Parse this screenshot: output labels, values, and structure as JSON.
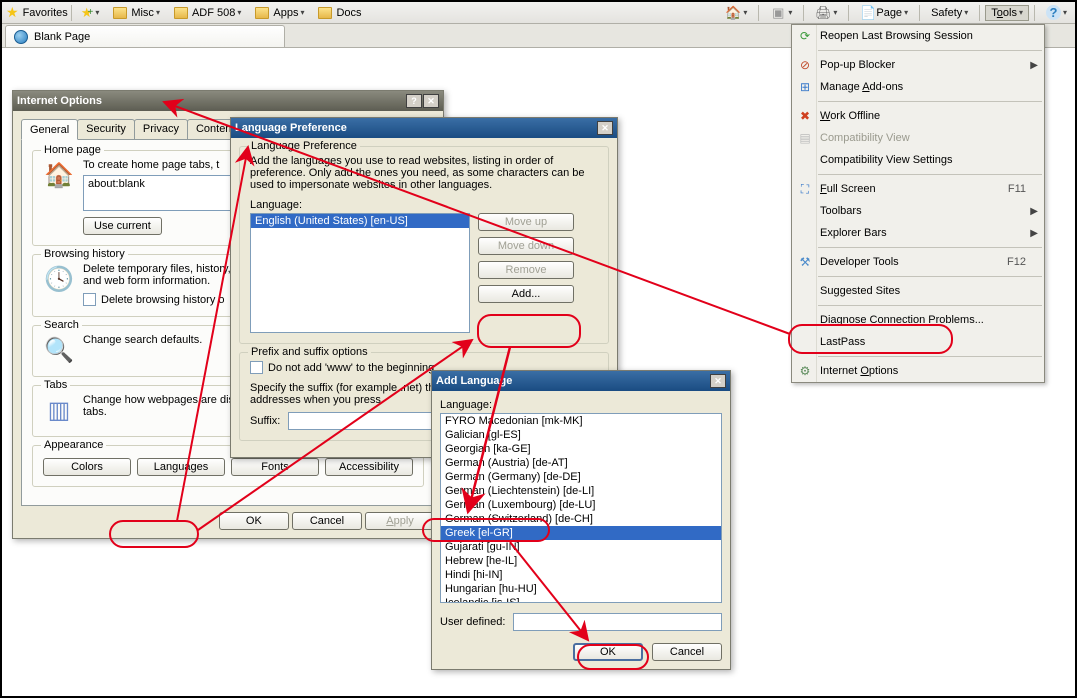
{
  "favorites_bar": {
    "label": "Favorites",
    "items": [
      {
        "label": "",
        "icon_only": true
      },
      {
        "label": "Misc"
      },
      {
        "label": "ADF 508"
      },
      {
        "label": "Apps"
      },
      {
        "label": "Docs"
      }
    ],
    "right_tools": {
      "page": "Page",
      "safety": "Safety",
      "tools": "Tools"
    }
  },
  "browser_tab": {
    "title": "Blank Page"
  },
  "tools_menu": {
    "items": [
      {
        "label": "Reopen Last Browsing Session",
        "icon": "reopen"
      },
      {
        "sep": true
      },
      {
        "label": "Pop-up Blocker",
        "icon": "popup",
        "submenu": true
      },
      {
        "label": "Manage Add-ons",
        "icon": "addon",
        "u": 7
      },
      {
        "sep": true
      },
      {
        "label": "Work Offline",
        "icon": "offline",
        "u": 0
      },
      {
        "label": "Compatibility View",
        "icon": "compat",
        "disabled": true
      },
      {
        "label": "Compatibility View Settings"
      },
      {
        "sep": true
      },
      {
        "label": "Full Screen",
        "icon": "fullscreen",
        "shortcut": "F11",
        "u": 0
      },
      {
        "label": "Toolbars",
        "submenu": true
      },
      {
        "label": "Explorer Bars",
        "submenu": true
      },
      {
        "sep": true
      },
      {
        "label": "Developer Tools",
        "icon": "devtools",
        "shortcut": "F12"
      },
      {
        "sep": true
      },
      {
        "label": "Suggested Sites"
      },
      {
        "sep": true
      },
      {
        "label": "Diagnose Connection Problems..."
      },
      {
        "label": "LastPass"
      },
      {
        "sep": true
      },
      {
        "label": "Internet Options",
        "icon": "options",
        "u": 9
      }
    ]
  },
  "internet_options": {
    "title": "Internet Options",
    "tabs": [
      "General",
      "Security",
      "Privacy",
      "Content"
    ],
    "homepage": {
      "legend": "Home page",
      "text": "To create home page tabs, t",
      "value": "about:blank",
      "use_current": "Use current"
    },
    "history": {
      "legend": "Browsing history",
      "text": "Delete temporary files, history, cookies, saved passwords, and web form information.",
      "delete_cb": "Delete browsing history o"
    },
    "search": {
      "legend": "Search",
      "text": "Change search defaults."
    },
    "tabs_section": {
      "legend": "Tabs",
      "text": "Change how webpages are displayed in tabs."
    },
    "appearance": {
      "legend": "Appearance",
      "colors": "Colors",
      "languages": "Languages",
      "fonts": "Fonts",
      "accessibility": "Accessibility"
    },
    "ok": "OK",
    "cancel": "Cancel",
    "apply": "Apply"
  },
  "language_pref": {
    "title": "Language Preference",
    "legend": "Language Preference",
    "desc": "Add the languages you use to read websites, listing in order of preference. Only add the ones you need, as some characters can be used to impersonate websites in other languages.",
    "lang_label": "Language:",
    "selected": "English (United States) [en-US]",
    "move_up": "Move up",
    "move_down": "Move down",
    "remove": "Remove",
    "add": "Add...",
    "prefix_legend": "Prefix and suffix options",
    "prefix_cb": "Do not add 'www' to the beginning",
    "suffix_desc": "Specify the suffix (for example .net) that should be added to typed web addresses when you press",
    "suffix_label": "Suffix:"
  },
  "add_language": {
    "title": "Add Language",
    "lang_label": "Language:",
    "items": [
      "FYRO Macedonian [mk-MK]",
      "Galician [gl-ES]",
      "Georgian [ka-GE]",
      "German (Austria) [de-AT]",
      "German (Germany) [de-DE]",
      "German (Liechtenstein) [de-LI]",
      "German (Luxembourg) [de-LU]",
      "German (Switzerland) [de-CH]",
      "Greek [el-GR]",
      "Gujarati [gu-IN]",
      "Hebrew [he-IL]",
      "Hindi [hi-IN]",
      "Hungarian [hu-HU]",
      "Icelandic [is-IS]"
    ],
    "selected_index": 8,
    "user_defined": "User defined:",
    "ok": "OK",
    "cancel": "Cancel"
  }
}
